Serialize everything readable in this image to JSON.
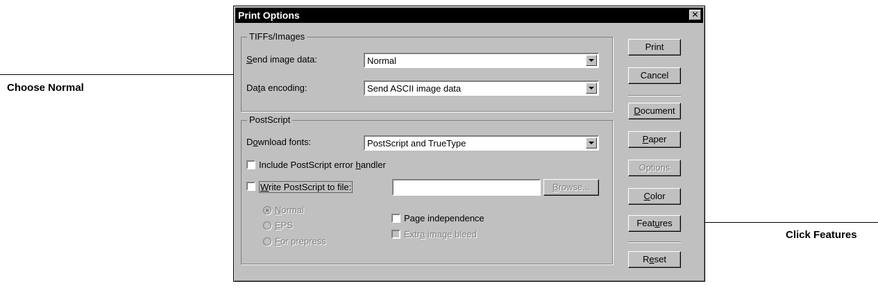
{
  "annotations": {
    "left": "Choose Normal",
    "right": "Click Features"
  },
  "dialog": {
    "title": "Print Options",
    "close_glyph": "✕",
    "tiffs": {
      "group_label": "TIFFs/Images",
      "send_label": "Send image data:",
      "send_value": "Normal",
      "encoding_label": "Data encoding:",
      "encoding_value": "Send ASCII image data"
    },
    "postscript": {
      "group_label": "PostScript",
      "download_label": "Download fonts:",
      "download_value": "PostScript and TrueType",
      "include_handler": "Include PostScript error handler",
      "write_to_file": "Write PostScript to file:",
      "browse": "Browse...",
      "radio_normal": "Normal",
      "radio_eps": "EPS",
      "radio_prepress": "For prepress",
      "page_independence": "Page independence",
      "extra_bleed": "Extra image bleed"
    },
    "buttons": {
      "print": "Print",
      "cancel": "Cancel",
      "document": "Document",
      "paper": "Paper",
      "options": "Options",
      "color": "Color",
      "features": "Features",
      "reset": "Reset"
    }
  }
}
